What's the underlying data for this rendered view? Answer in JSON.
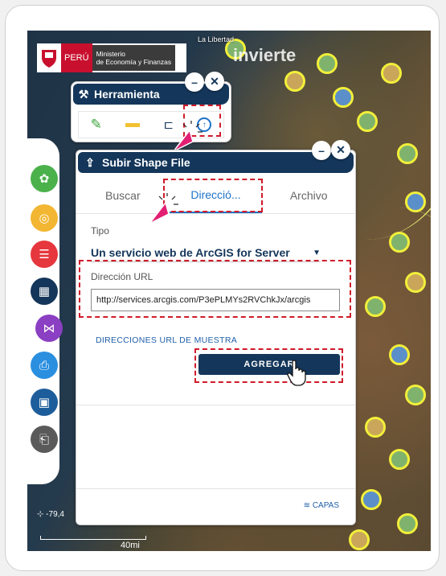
{
  "logo": {
    "peru": "PERÚ",
    "ministry_line1": "Ministerio",
    "ministry_line2": "de Economía y Finanzas"
  },
  "map": {
    "region_label": "La Libertad",
    "brand_text": "invierte",
    "coordinate": "-79,4",
    "scale": "40mi"
  },
  "toolbar": {
    "title": "Herramienta",
    "tools": [
      {
        "icon": "pencil-icon"
      },
      {
        "icon": "ruler-icon"
      },
      {
        "icon": "hierarchy-icon"
      },
      {
        "icon": "upload-circle-icon"
      }
    ]
  },
  "side_buttons": [
    {
      "icon": "leaf-icon",
      "color": "#4bb14b"
    },
    {
      "icon": "layers-icon",
      "color": "#f2b632"
    },
    {
      "icon": "list-icon",
      "color": "#e5373d"
    },
    {
      "icon": "grid-icon",
      "color": "#14365a"
    },
    {
      "icon": "share-icon",
      "color": "#8b3fc2"
    },
    {
      "icon": "print-icon",
      "color": "#2b8fe0"
    },
    {
      "icon": "save-icon",
      "color": "#1d5d9b"
    },
    {
      "icon": "clipboard-icon",
      "color": "#5a5a5a"
    }
  ],
  "panel": {
    "title": "Subir Shape File",
    "tabs": [
      "Buscar",
      "Direcció...",
      "Archivo"
    ],
    "type_label": "Tipo",
    "type_value": "Un servicio web de ArcGIS for Server",
    "url_label": "Dirección URL",
    "url_value": "http://services.arcgis.com/P3ePLMYs2RVChkJx/arcgis",
    "samples_link": "DIRECCIONES URL DE MUESTRA",
    "add_button": "AGREGAR",
    "capas": "CAPAS"
  },
  "colors": {
    "navy": "#14365a",
    "accent_blue": "#1e73c8",
    "highlight_red": "#d01a2a",
    "marker_yellow": "#f2ef3a"
  }
}
